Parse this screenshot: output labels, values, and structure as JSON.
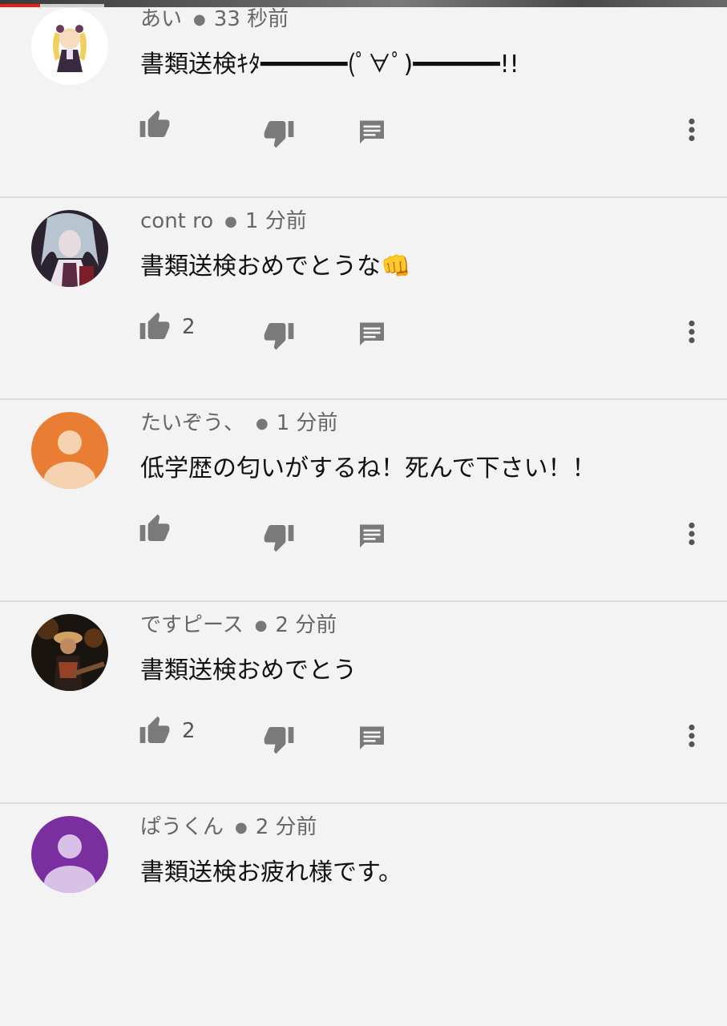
{
  "video_player": {
    "progress": 0.055
  },
  "colors": {
    "background": "#f3f3f3",
    "progress_played": "#e62117",
    "icon_gray": "#7a7a7a",
    "avatar_orange": "#e87d33",
    "avatar_purple": "#7a2ea0"
  },
  "comments": [
    {
      "author": "あい",
      "time": "33 秒前",
      "text": "書類送検ｷﾀ━━━━━━(ﾟ∀ﾟ)━━━━━━!!",
      "likes": "",
      "avatar": "anime-doll-avatar"
    },
    {
      "author": "cont ro",
      "time": "1 分前",
      "text": "書類送検おめでとうな👊",
      "likes": "2",
      "avatar": "anime-character-avatar"
    },
    {
      "author": "たいぞう、",
      "time": "1 分前",
      "text": "低学歴の匂いがするね！死んで下さい！！",
      "likes": "",
      "avatar": "default-orange-avatar"
    },
    {
      "author": "ですピース",
      "time": "2 分前",
      "text": "書類送検おめでとう",
      "likes": "2",
      "avatar": "guitarist-photo-avatar"
    },
    {
      "author": "ぱうくん",
      "time": "2 分前",
      "text": "書類送検お疲れ様です。",
      "likes": "",
      "avatar": "default-purple-avatar"
    }
  ]
}
